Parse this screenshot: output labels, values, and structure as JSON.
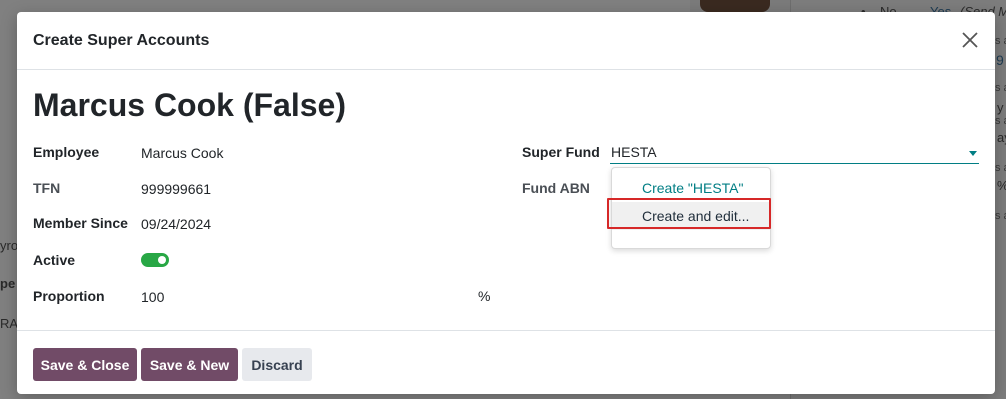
{
  "background": {
    "texts": [
      {
        "id": "bg-no",
        "text": "No"
      },
      {
        "id": "bg-arrow",
        "text": "→"
      },
      {
        "id": "bg-yes",
        "text": "Yes"
      },
      {
        "id": "bg-paren",
        "text": "(Send M"
      },
      {
        "id": "bg-a1",
        "text": "s a"
      },
      {
        "id": "bg-9",
        "text": "9"
      },
      {
        "id": "bg-a2",
        "text": "s a"
      },
      {
        "id": "bg-y",
        "text": "y"
      },
      {
        "id": "bg-a3",
        "text": "s a"
      },
      {
        "id": "bg-ay",
        "text": "ay"
      },
      {
        "id": "bg-a4",
        "text": "s a"
      },
      {
        "id": "bg-pct",
        "text": "%"
      },
      {
        "id": "bg-a5",
        "text": "s a"
      },
      {
        "id": "bg-yro",
        "text": "yro"
      },
      {
        "id": "bg-pe",
        "text": "pe"
      },
      {
        "id": "bg-ra",
        "text": "RA"
      }
    ]
  },
  "modal": {
    "title": "Create Super Accounts",
    "record_name": "Marcus Cook (False)",
    "fields": {
      "employee_label": "Employee",
      "employee_value": "Marcus Cook",
      "tfn_label": "TFN",
      "tfn_value": "999999661",
      "member_since_label": "Member Since",
      "member_since_value": "09/24/2024",
      "active_label": "Active",
      "active_value": true,
      "proportion_label": "Proportion",
      "proportion_value": "100",
      "proportion_unit": "%",
      "super_fund_label": "Super Fund",
      "super_fund_value": "HESTA",
      "fund_abn_label": "Fund ABN"
    },
    "dropdown": {
      "create_label": "Create \"HESTA\"",
      "create_edit_label": "Create and edit..."
    },
    "footer": {
      "save_close": "Save & Close",
      "save_new": "Save & New",
      "discard": "Discard"
    }
  },
  "colors": {
    "primary": "#714b67",
    "accent": "#017e84",
    "toggle_on": "#28a745",
    "highlight": "#d62828"
  },
  "icons": {
    "close": "close-icon",
    "caret": "caret-down-icon"
  }
}
